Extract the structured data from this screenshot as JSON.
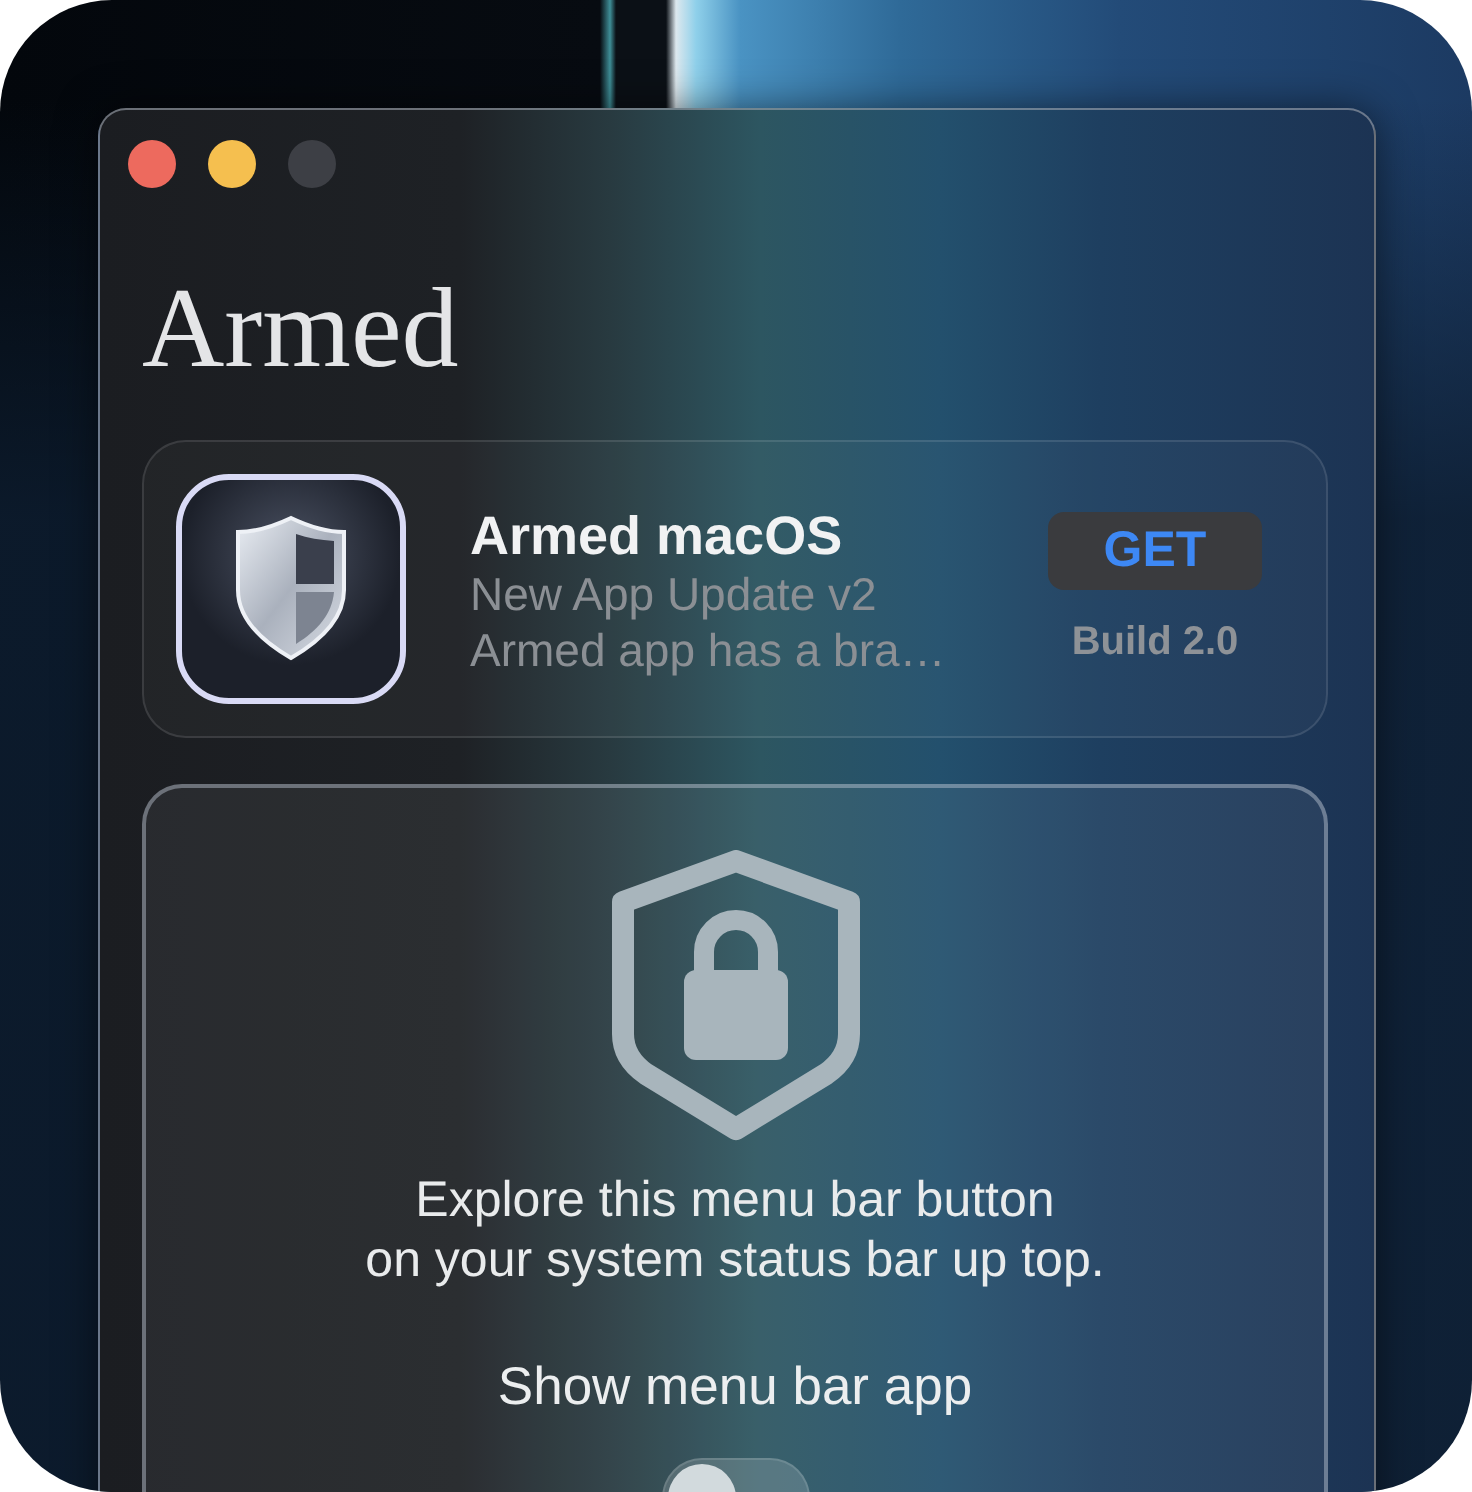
{
  "window": {
    "controls": [
      {
        "color": "#ed6a5e"
      },
      {
        "color": "#f5bf4f"
      },
      {
        "color": "#3d3f45"
      }
    ],
    "heading": "Armed"
  },
  "update_card": {
    "app_name": "Armed macOS",
    "subtitle": "New App Update v2",
    "description": "Armed app has a bra…",
    "button": "GET",
    "build": "Build 2.0"
  },
  "menu_bar_card": {
    "message_lines": [
      "Explore this menu bar button",
      "on your system status bar up top."
    ],
    "toggle": {
      "label": "Show menu bar app",
      "on": false
    }
  }
}
